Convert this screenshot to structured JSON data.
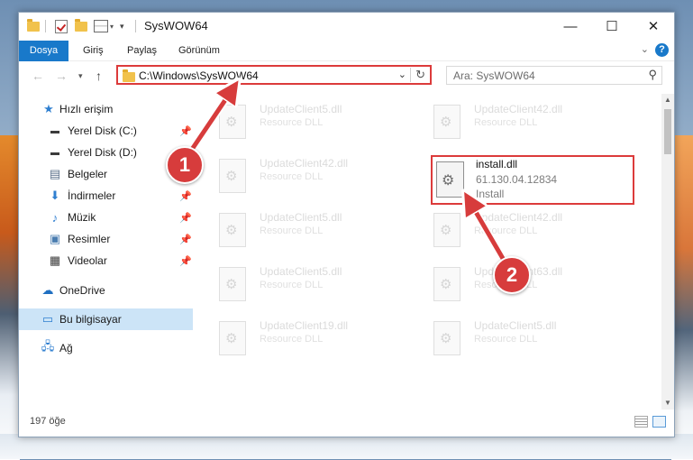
{
  "window": {
    "title": "SysWOW64",
    "minimize": "—",
    "maximize": "☐",
    "close": "✕"
  },
  "ribbon": {
    "tabs": [
      "Dosya",
      "Giriş",
      "Paylaş",
      "Görünüm"
    ],
    "help": "?"
  },
  "navigation": {
    "address": "C:\\Windows\\SysWOW64",
    "search_placeholder": "Ara: SysWOW64"
  },
  "sidebar": {
    "items": [
      {
        "label": "Hızlı erişim",
        "icon": "star-icon"
      },
      {
        "label": "Yerel Disk (C:)",
        "icon": "drive-icon",
        "pinned": true
      },
      {
        "label": "Yerel Disk (D:)",
        "icon": "drive-icon",
        "pinned": true
      },
      {
        "label": "Belgeler",
        "icon": "documents-icon",
        "pinned": false
      },
      {
        "label": "İndirmeler",
        "icon": "download-icon",
        "pinned": true
      },
      {
        "label": "Müzik",
        "icon": "music-icon",
        "pinned": true
      },
      {
        "label": "Resimler",
        "icon": "pictures-icon",
        "pinned": true
      },
      {
        "label": "Videolar",
        "icon": "videos-icon",
        "pinned": true
      },
      {
        "label": "OneDrive",
        "icon": "cloud-icon"
      },
      {
        "label": "Bu bilgisayar",
        "icon": "computer-icon",
        "selected": true
      },
      {
        "label": "Ağ",
        "icon": "network-icon"
      }
    ]
  },
  "files": [
    {
      "name": "UpdateClient5.dll",
      "desc": "Resource DLL"
    },
    {
      "name": "UpdateClient42.dll",
      "desc": "Resource DLL"
    },
    {
      "name": "UpdateClient42.dll",
      "desc": "Resource DLL"
    },
    {
      "name": "UpdateClient5.dll",
      "desc": "Resource DLL"
    },
    {
      "name": "UpdateClient42.dll",
      "desc": "Resource DLL"
    },
    {
      "name": "UpdateClient5.dll",
      "desc": "Resource DLL"
    },
    {
      "name": "UpdateClient63.dll",
      "desc": "Resource DLL"
    },
    {
      "name": "UpdateClient19.dll",
      "desc": "Resource DLL"
    },
    {
      "name": "UpdateClient5.dll",
      "desc": "Resource DLL"
    }
  ],
  "selected_file": {
    "name": "install.dll",
    "version": "61.130.04.12834",
    "desc": "Install"
  },
  "status": {
    "count": "197 öğe"
  },
  "annotations": {
    "step1": "1",
    "step2": "2",
    "color": "#d73c3c"
  }
}
